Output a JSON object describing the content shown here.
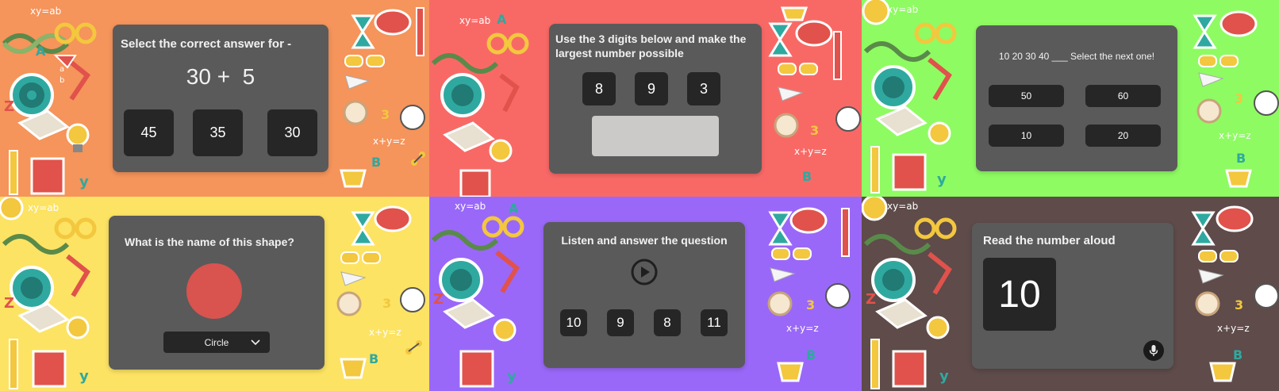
{
  "colors": {
    "panel1_bg": "#f5945b",
    "panel2_bg": "#f86966",
    "panel3_bg": "#8efb62",
    "panel4_bg": "#fce363",
    "panel5_bg": "#9a68f8",
    "panel6_bg": "#5e4b4a",
    "card_bg": "#5a5a5a",
    "button_bg": "#262626",
    "circle_shape": "#d9534f"
  },
  "panel1": {
    "question": "Select the correct answer for -",
    "expression": "30 +  5",
    "options": [
      "45",
      "35",
      "30"
    ]
  },
  "panel2": {
    "instruction_pre": "Use the 3 digits below and make the",
    "instruction_bold": "largest",
    "instruction_post": " number possible",
    "digits": [
      "8",
      "9",
      "3"
    ]
  },
  "panel3": {
    "question": "10 20 30 40 ___ Select the next one!",
    "options": [
      "50",
      "60",
      "10",
      "20"
    ]
  },
  "panel4": {
    "question": "What is the name of this shape?",
    "selected_option": "Circle"
  },
  "panel5": {
    "question": "Listen and answer the question",
    "options": [
      "10",
      "9",
      "8",
      "11"
    ]
  },
  "panel6": {
    "question": "Read the number aloud",
    "number": "10"
  },
  "background_icons": [
    "dna-icon",
    "target-icon",
    "lamp-icon",
    "hourglass-icon",
    "chat-bubble-icon",
    "glasses-icon",
    "pencil-icon",
    "book-icon",
    "lightbulb-icon",
    "graduation-cap-icon",
    "trophy-icon",
    "alarm-clock-icon",
    "soccer-ball-icon",
    "paper-plane-icon",
    "molecule-icon"
  ],
  "sticker_text": {
    "xy": "xy=ab",
    "xyz": "x+y=z",
    "a": "A",
    "b": "B",
    "y": "y",
    "z": "Z",
    "three": "3",
    "fraction_top": "a",
    "fraction_bottom": "b"
  }
}
